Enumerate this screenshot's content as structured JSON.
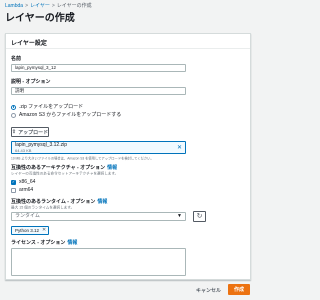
{
  "breadcrumb": {
    "items": [
      "Lambda",
      "レイヤー",
      "レイヤーの作成"
    ],
    "separator": ">"
  },
  "page": {
    "title": "レイヤーの作成"
  },
  "panel": {
    "title": "レイヤー設定"
  },
  "fields": {
    "name": {
      "label": "名前",
      "value": "lapin_pymysql_3_12"
    },
    "description": {
      "label": "説明 - オプション",
      "value": "説明"
    },
    "upload": {
      "option_zip": ".zip ファイルをアップロード",
      "option_s3": "Amazon S3 からファイルをアップロードする",
      "selected": "zip",
      "button_label": "アップロード",
      "file_name": "lapin_pymysql_3.12.zip",
      "file_size": "64.43 KB",
      "hint": "10 MB より大きいファイルの場合は、Amazon S3 を使用してアップロードを検討してください。"
    },
    "architectures": {
      "label": "互換性のあるアーキテクチャ - オプション",
      "info": "情報",
      "hint": "レイヤーの互換性のある命令セットアーキテクチャを選択します。",
      "options": [
        {
          "label": "x86_64",
          "checked": true
        },
        {
          "label": "arm64",
          "checked": false
        }
      ]
    },
    "runtimes": {
      "label": "互換性のあるランタイム - オプション",
      "info": "情報",
      "hint": "最大 15 個のランタイムを選択します。",
      "placeholder": "ランタイム",
      "tokens": [
        "Python 3.12"
      ]
    },
    "license": {
      "label": "ライセンス - オプション",
      "info": "情報",
      "value": ""
    }
  },
  "footer": {
    "cancel_label": "キャンセル",
    "create_label": "作成"
  },
  "colors": {
    "primary": "#ec7211",
    "link": "#0073bb",
    "background": "#f2f3f3"
  },
  "icons": {
    "upload": "upload-icon",
    "refresh": "refresh-icon",
    "close": "close-icon",
    "dropdown": "caret-down-icon"
  }
}
